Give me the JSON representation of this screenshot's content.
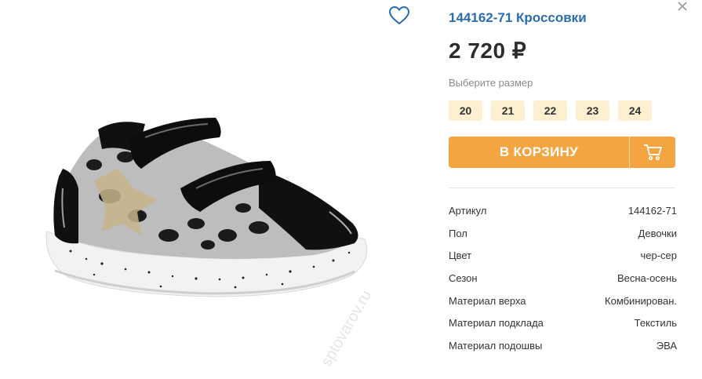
{
  "product": {
    "title": "144162-71 Кроссовки",
    "price": "2 720 ₽",
    "size_hint": "Выберите размер",
    "sizes": [
      "20",
      "21",
      "22",
      "23",
      "24"
    ],
    "cart_label": "В КОРЗИНУ"
  },
  "specs": [
    {
      "label": "Артикул",
      "value": "144162-71"
    },
    {
      "label": "Пол",
      "value": "Девочки"
    },
    {
      "label": "Цвет",
      "value": "чер-сер"
    },
    {
      "label": "Сезон",
      "value": "Весна-осень"
    },
    {
      "label": "Материал верха",
      "value": "Комбинирован."
    },
    {
      "label": "Материал подклада",
      "value": "Текстиль"
    },
    {
      "label": "Материал подошвы",
      "value": "ЭВА"
    }
  ],
  "watermark": "sptovarov.ru",
  "icons": {
    "wishlist": "heart-outline-icon",
    "close": "close-icon",
    "cart": "shopping-cart-icon"
  },
  "colors": {
    "accent": "#f5a442",
    "title": "#2b6cb0",
    "size_bg": "#fdf0d0"
  }
}
